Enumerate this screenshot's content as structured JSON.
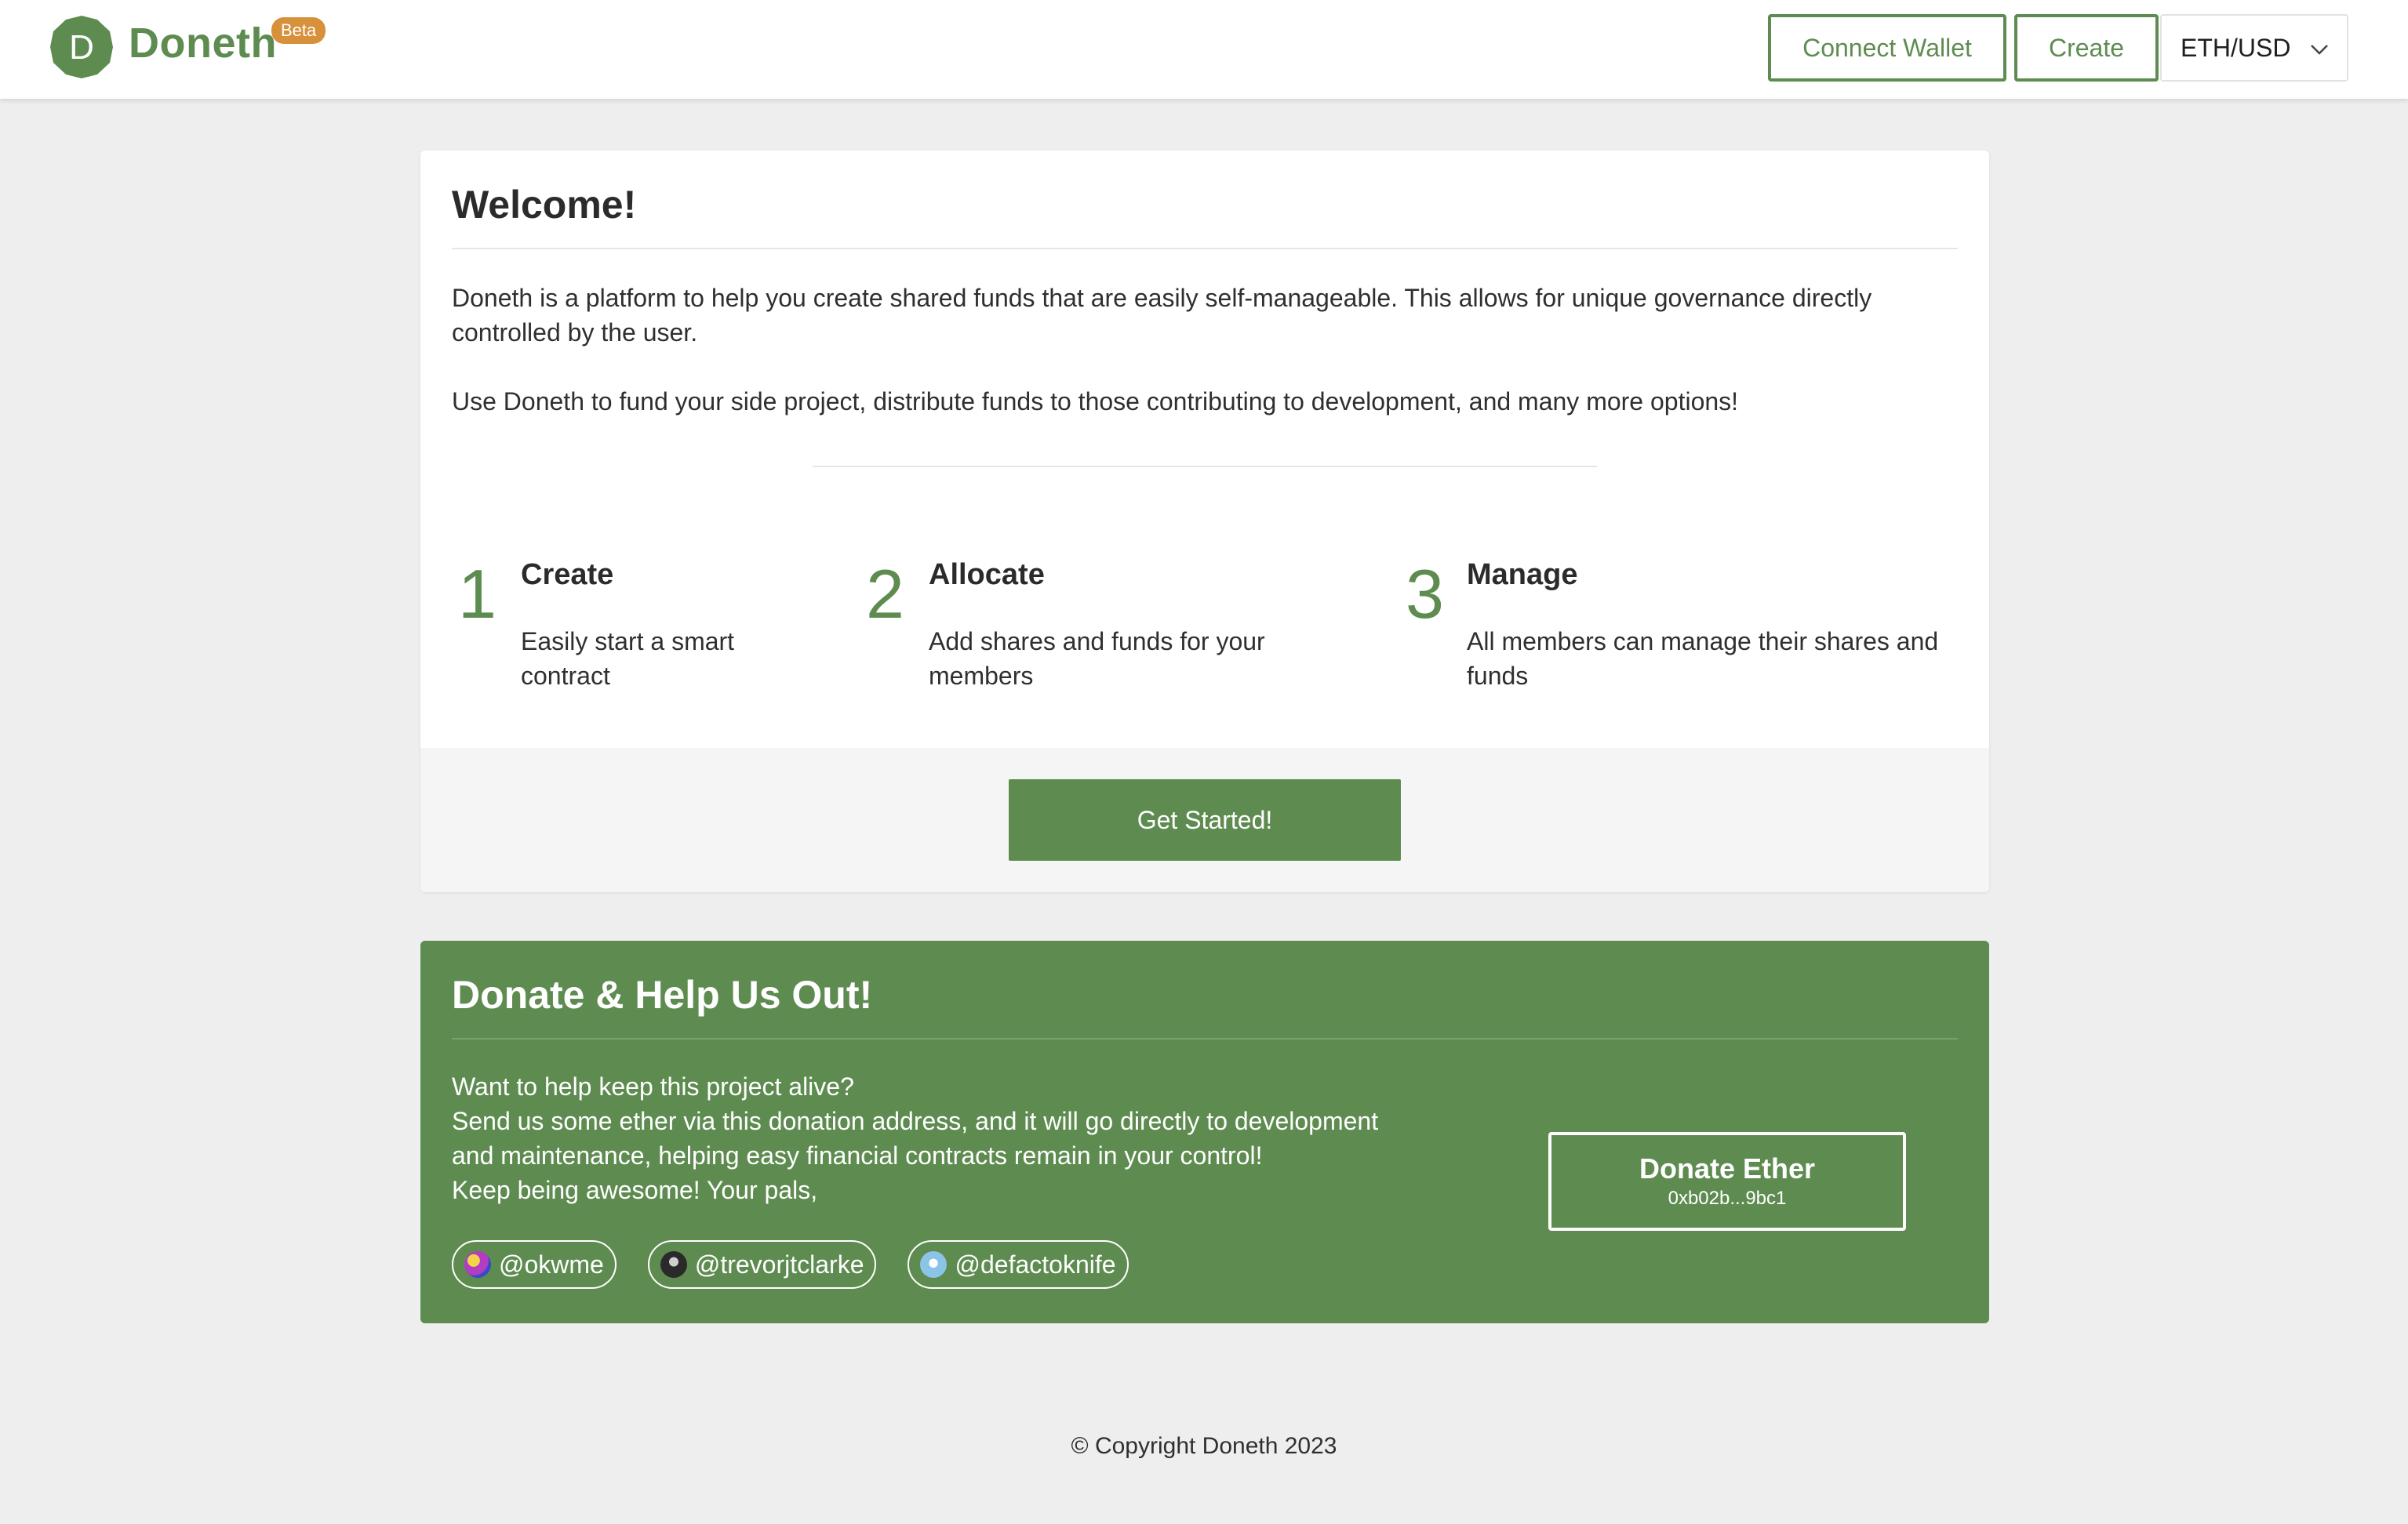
{
  "header": {
    "brand_initial": "D",
    "brand_name": "Doneth",
    "beta_label": "Beta",
    "connect_wallet_label": "Connect Wallet",
    "create_label": "Create",
    "currency_selected": "ETH/USD"
  },
  "welcome": {
    "title": "Welcome!",
    "paragraph_1": "Doneth is a platform to help you create shared funds that are easily self-manageable. This allows for unique governance directly controlled by the user.",
    "paragraph_2": "Use Doneth to fund your side project, distribute funds to those contributing to development, and many more options!",
    "steps": [
      {
        "number": "1",
        "title": "Create",
        "description": "Easily start a smart contract"
      },
      {
        "number": "2",
        "title": "Allocate",
        "description": "Add shares and funds for your members"
      },
      {
        "number": "3",
        "title": "Manage",
        "description": "All members can manage their shares and funds"
      }
    ],
    "get_started_label": "Get Started!"
  },
  "donate": {
    "title": "Donate & Help Us Out!",
    "lines": [
      "Want to help keep this project alive?",
      "Send us some ether via this donation address, and it will go directly to development and maintenance, helping easy financial contracts remain in your control!",
      "Keep being awesome! Your pals,"
    ],
    "handles": [
      "@okwme",
      "@trevorjtclarke",
      "@defactoknife"
    ],
    "button_label": "Donate Ether",
    "address": "0xb02b...9bc1"
  },
  "footer": {
    "copyright": "© Copyright Doneth 2023"
  },
  "colors": {
    "brand_green": "#5e8c50",
    "beta_orange": "#d6913a",
    "page_background": "#eeeeee"
  }
}
